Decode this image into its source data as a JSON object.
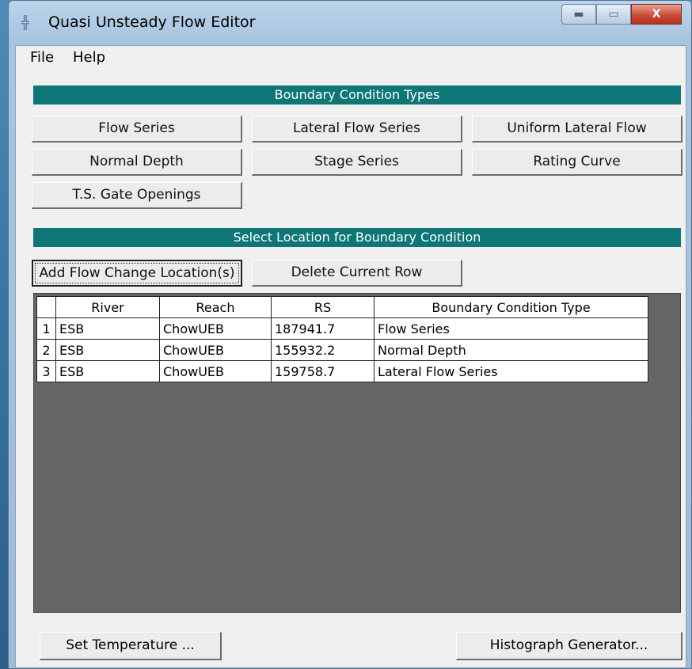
{
  "window": {
    "title": "Quasi Unsteady Flow Editor",
    "controls": {
      "minimize": "▬",
      "maximize": "▭",
      "close": "X"
    }
  },
  "menu": {
    "file": "File",
    "help": "Help"
  },
  "bc_types": {
    "header": "Boundary Condition Types",
    "flow_series": "Flow Series",
    "lateral_flow_series": "Lateral Flow Series",
    "uniform_lateral_flow": "Uniform Lateral Flow",
    "normal_depth": "Normal Depth",
    "stage_series": "Stage Series",
    "rating_curve": "Rating Curve",
    "ts_gate_openings": "T.S. Gate Openings"
  },
  "location": {
    "header": "Select Location for Boundary Condition",
    "add_flow_change": "Add Flow Change Location(s)",
    "delete_row": "Delete Current Row"
  },
  "table": {
    "columns": [
      "",
      "River",
      "Reach",
      "RS",
      "Boundary Condition Type"
    ],
    "rows": [
      {
        "num": "1",
        "river": "ESB",
        "reach": "ChowUEB",
        "rs": "187941.7",
        "bc_type": "Flow Series"
      },
      {
        "num": "2",
        "river": "ESB",
        "reach": "ChowUEB",
        "rs": "155932.2",
        "bc_type": "Normal Depth"
      },
      {
        "num": "3",
        "river": "ESB",
        "reach": "ChowUEB",
        "rs": "159758.7",
        "bc_type": "Lateral Flow Series"
      }
    ]
  },
  "footer": {
    "set_temperature": "Set Temperature ...",
    "histograph_generator": "Histograph Generator..."
  },
  "colors": {
    "header_teal": "#0f7678",
    "grid_background": "#666666"
  }
}
